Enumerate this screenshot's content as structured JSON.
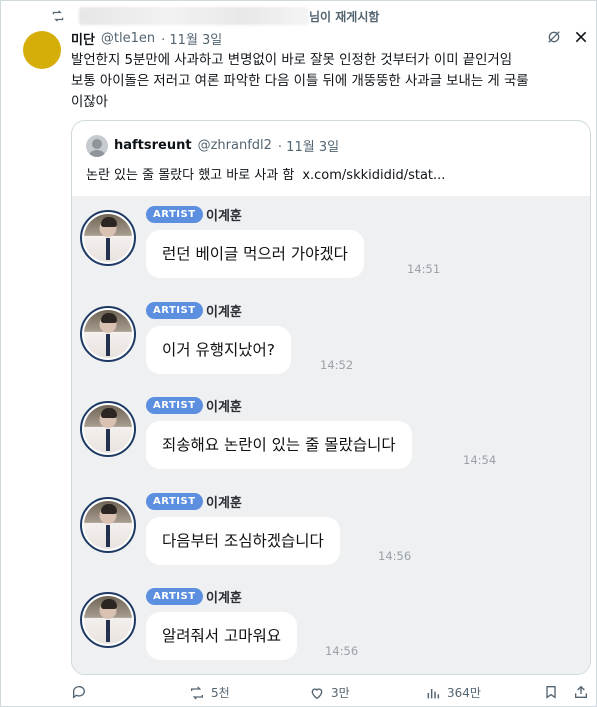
{
  "retweet": {
    "text": "님이 재게시함"
  },
  "post": {
    "name": "미단",
    "handle": "@tle1en",
    "date": "· 11월 3일",
    "lines": [
      "발언한지 5분만에 사과하고 변명없이 바로 잘못 인정한 것부터가 이미 끝인거임",
      "보통 아이돌은 저러고 여론 파악한 다음 이틀 뒤에 개뚱뚱한 사과글 보내는 게 국룰",
      "이잖아"
    ],
    "avatar_color": "#d6ae0a"
  },
  "quote": {
    "name": "haftsreunt",
    "handle": "@zhranfdl2",
    "date": "· 11월 3일",
    "text": "논란 있는 줄 몰랐다 했고 바로 사과 함",
    "link": "x.com/skkididid/stat..."
  },
  "chat": {
    "badge": "ARTIST",
    "sender": "이계훈",
    "badge_color": "#5d8fe0",
    "messages": [
      {
        "text": "런던 베이글 먹으러 가야겠다",
        "time": "14:51"
      },
      {
        "text": "이거 유행지났어?",
        "time": "14:52"
      },
      {
        "text": "죄송해요 논란이 있는 줄 몰랐습니다",
        "time": "14:54"
      },
      {
        "text": "다음부터 조심하겠습니다",
        "time": "14:56"
      },
      {
        "text": "알려줘서 고마워요",
        "time": "14:56"
      }
    ]
  },
  "actions": {
    "reply_count": "",
    "retweet_count": "5천",
    "like_count": "3만",
    "view_count": "364만"
  },
  "icons": [
    "retweet-icon",
    "grok-icon",
    "close-icon",
    "reply-icon",
    "like-icon",
    "views-icon",
    "bookmark-icon",
    "share-icon"
  ]
}
